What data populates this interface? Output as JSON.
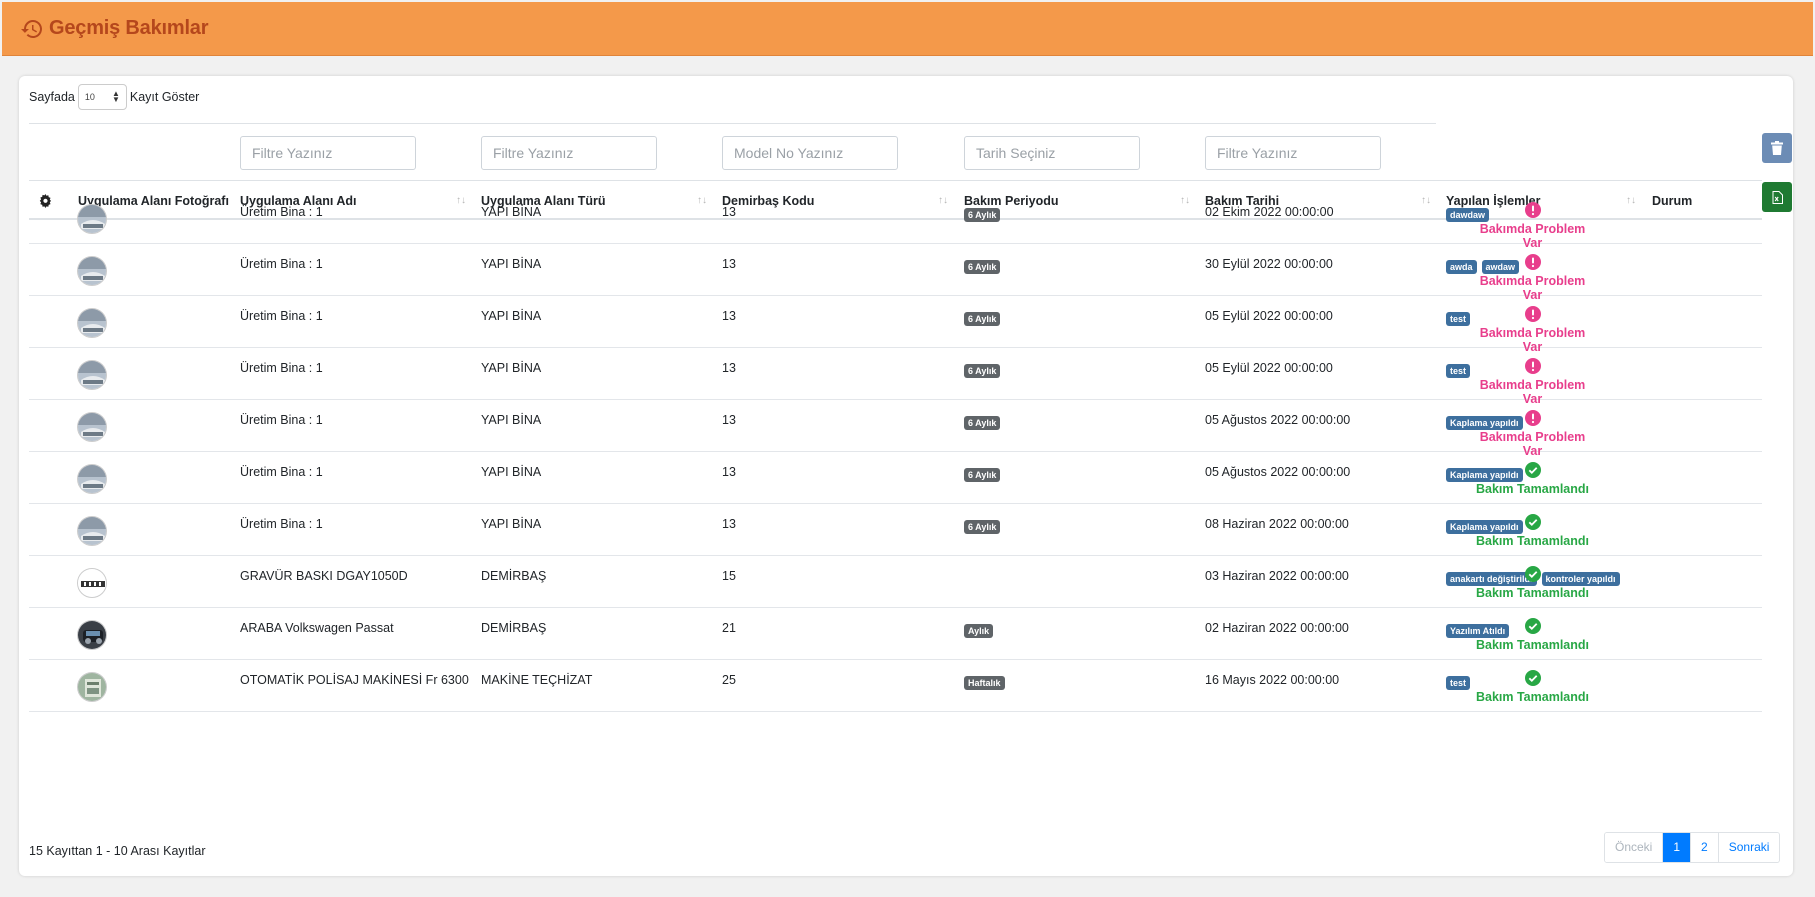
{
  "header": {
    "title": "Geçmiş Bakımlar",
    "icon": "history-icon",
    "color": "#f4994a"
  },
  "length": {
    "prefix": "Sayfada",
    "value": "10",
    "suffix": "Kayıt Göster"
  },
  "filters": [
    {
      "placeholder": "Filtre Yazınız"
    },
    {
      "placeholder": "Filtre Yazınız"
    },
    {
      "placeholder": "Model No Yazınız"
    },
    {
      "placeholder": "Tarih Seçiniz"
    },
    {
      "placeholder": "Filtre Yazınız"
    }
  ],
  "columns": {
    "photo": "Uygulama Alanı Fotoğrafı",
    "name": "Uygulama Alanı Adı",
    "type": "Uygulama Alanı Türü",
    "code": "Demirbaş Kodu",
    "period": "Bakım Periyodu",
    "date": "Bakım Tarihi",
    "ops": "Yapılan İşlemler",
    "status": "Durum"
  },
  "rows": [
    {
      "name": "Üretim Bina : 1",
      "type": "YAPI BİNA",
      "code": "13",
      "period": "6 Aylık",
      "date": "02 Ekim 2022 00:00:00",
      "ops": [
        "dawdaw"
      ],
      "status": "Bakımda Problem Var"
    },
    {
      "name": "Üretim Bina : 1",
      "type": "YAPI BİNA",
      "code": "13",
      "period": "6 Aylık",
      "date": "30 Eylül 2022 00:00:00",
      "ops": [
        "awda",
        "awdaw"
      ],
      "status": "Bakımda Problem Var"
    },
    {
      "name": "Üretim Bina : 1",
      "type": "YAPI BİNA",
      "code": "13",
      "period": "6 Aylık",
      "date": "05 Eylül 2022 00:00:00",
      "ops": [
        "test"
      ],
      "status": "Bakımda Problem Var"
    },
    {
      "name": "Üretim Bina : 1",
      "type": "YAPI BİNA",
      "code": "13",
      "period": "6 Aylık",
      "date": "05 Eylül 2022 00:00:00",
      "ops": [
        "test"
      ],
      "status": "Bakımda Problem Var"
    },
    {
      "name": "Üretim Bina : 1",
      "type": "YAPI BİNA",
      "code": "13",
      "period": "6 Aylık",
      "date": "05 Ağustos 2022 00:00:00",
      "ops": [
        "Kaplama yapıldı"
      ],
      "status": "Bakımda Problem Var"
    },
    {
      "name": "Üretim Bina : 1",
      "type": "YAPI BİNA",
      "code": "13",
      "period": "6 Aylık",
      "date": "05 Ağustos 2022 00:00:00",
      "ops": [
        "Kaplama yapıldı"
      ],
      "status": "Bakım Tamamlandı"
    },
    {
      "name": "Üretim Bina : 1",
      "type": "YAPI BİNA",
      "code": "13",
      "period": "6 Aylık",
      "date": "08 Haziran 2022 00:00:00",
      "ops": [
        "Kaplama yapıldı"
      ],
      "status": "Bakım Tamamlandı"
    },
    {
      "name": "GRAVÜR BASKI DGAY1050D",
      "type": "DEMİRBAŞ",
      "code": "15",
      "period": "",
      "date": "03 Haziran 2022 00:00:00",
      "ops": [
        "anakartı değiştirildi",
        "kontroler yapıldı"
      ],
      "status": "Bakım Tamamlandı"
    },
    {
      "name": "ARABA Volkswagen Passat",
      "type": "DEMİRBAŞ",
      "code": "21",
      "period": "Aylık",
      "date": "02 Haziran 2022 00:00:00",
      "ops": [
        "Yazılım Atıldı"
      ],
      "status": "Bakım Tamamlandı"
    },
    {
      "name": "OTOMATİK POLİSAJ MAKİNESİ Fr 6300",
      "type": "MAKİNE TEÇHİZAT",
      "code": "25",
      "period": "Haftalık",
      "date": "16 Mayıs 2022 00:00:00",
      "ops": [
        "test"
      ],
      "status": "Bakım Tamamlandı"
    }
  ],
  "footer": {
    "info": "15 Kayıttan 1 - 10 Arası Kayıtlar",
    "prev": "Önceki",
    "pages": [
      "1",
      "2"
    ],
    "next": "Sonraki"
  },
  "colors": {
    "problem": "#e83e8c",
    "done": "#28a745",
    "badge_dark": "#5f6468",
    "badge_blue": "#3d6f9e"
  }
}
